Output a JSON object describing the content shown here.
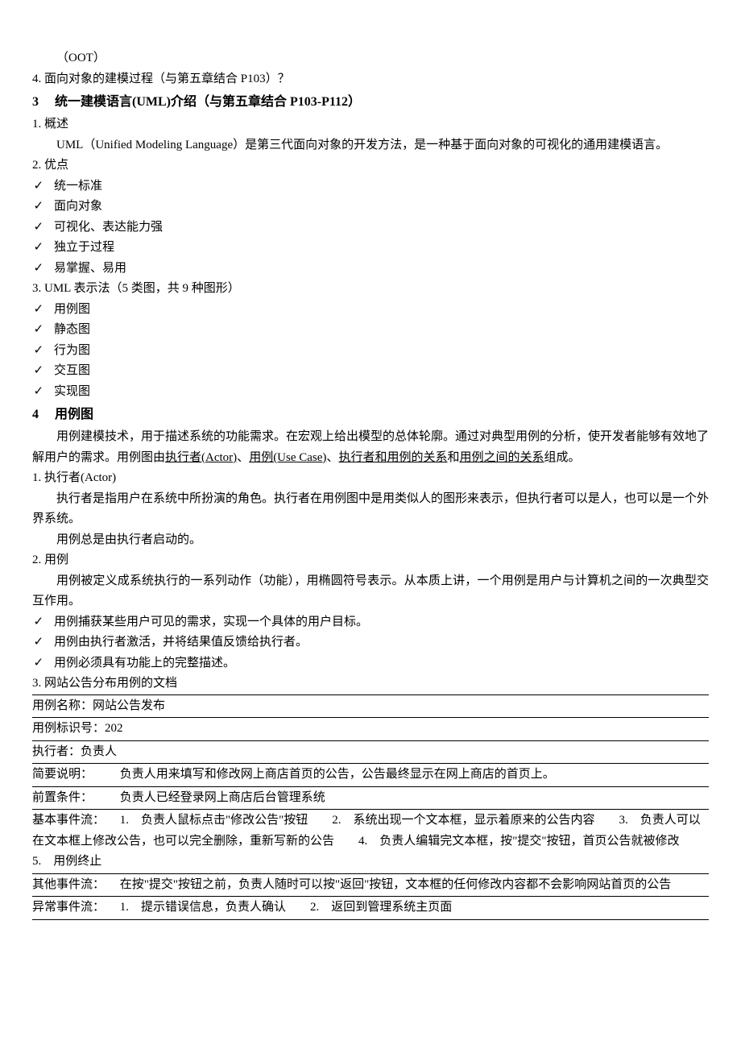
{
  "top": {
    "oot": "（OOT）",
    "item4": "4.  面向对象的建模过程（与第五章结合 P103）？"
  },
  "sec3": {
    "heading_num": "3",
    "heading_text": "统一建模语言(UML)介绍（与第五章结合 P103-P112）",
    "item1_label": "1.  概述",
    "item1_para": "UML（Unified Modeling Language）是第三代面向对象的开发方法，是一种基于面向对象的可视化的通用建模语言。",
    "item2_label": "2.  优点",
    "advantages": [
      "统一标准",
      "面向对象",
      "可视化、表达能力强",
      "独立于过程",
      "易掌握、易用"
    ],
    "item3_label": "3. UML 表示法（5 类图，共 9 种图形）",
    "diagrams": [
      "用例图",
      "静态图",
      "行为图",
      "交互图",
      "实现图"
    ]
  },
  "sec4": {
    "heading_num": "4",
    "heading_text": "用例图",
    "intro_pre": "用例建模技术，用于描述系统的功能需求。在宏观上给出模型的总体轮廓。通过对典型用例的分析，使开发者能够有效地了解用户的需求。用例图由",
    "u1": "执行者(Actor)",
    "u2": "用例(Use Case)",
    "u3": "执行者和用例的关系",
    "u4": "用例之间的关系",
    "intro_post": "组成。",
    "item1_label": "1.  执行者(Actor)",
    "item1_p1": "执行者是指用户在系统中所扮演的角色。执行者在用例图中是用类似人的图形来表示，但执行者可以是人，也可以是一个外界系统。",
    "item1_p2": "用例总是由执行者启动的。",
    "item2_label": "2.  用例",
    "item2_p1": "用例被定义成系统执行的一系列动作（功能），用椭圆符号表示。从本质上讲，一个用例是用户与计算机之间的一次典型交互作用。",
    "usecase_points": [
      "用例捕获某些用户可见的需求，实现一个具体的用户目标。",
      "用例由执行者激活，并将结果值反馈给执行者。",
      "用例必须具有功能上的完整描述。"
    ],
    "item3_label": "3.  网站公告分布用例的文档"
  },
  "usecase_doc": {
    "row_name": "用例名称：网站公告发布",
    "row_id": "用例标识号：202",
    "row_actor": "执行者：负责人",
    "row_desc_label": "简要说明：",
    "row_desc_text": "负责人用来填写和修改网上商店首页的公告，公告最终显示在网上商店的首页上。",
    "row_precond_label": "前置条件：",
    "row_precond_text": "负责人已经登录网上商店后台管理系统",
    "row_basic_label": "基本事件流：",
    "row_basic_text": "1.　负责人鼠标点击\"修改公告\"按钮　　2.　系统出现一个文本框，显示着原来的公告内容　　3.　负责人可以在文本框上修改公告，也可以完全删除，重新写新的公告　　4.　负责人编辑完文本框，按\"提交\"按钮，首页公告就被修改　　5.　用例终止",
    "row_other_label": "其他事件流：",
    "row_other_text": "在按\"提交\"按钮之前，负责人随时可以按\"返回\"按钮，文本框的任何修改内容都不会影响网站首页的公告",
    "row_exception_label": "异常事件流：",
    "row_exception_text": "1.　提示错误信息，负责人确认　　2.　返回到管理系统主页面"
  }
}
